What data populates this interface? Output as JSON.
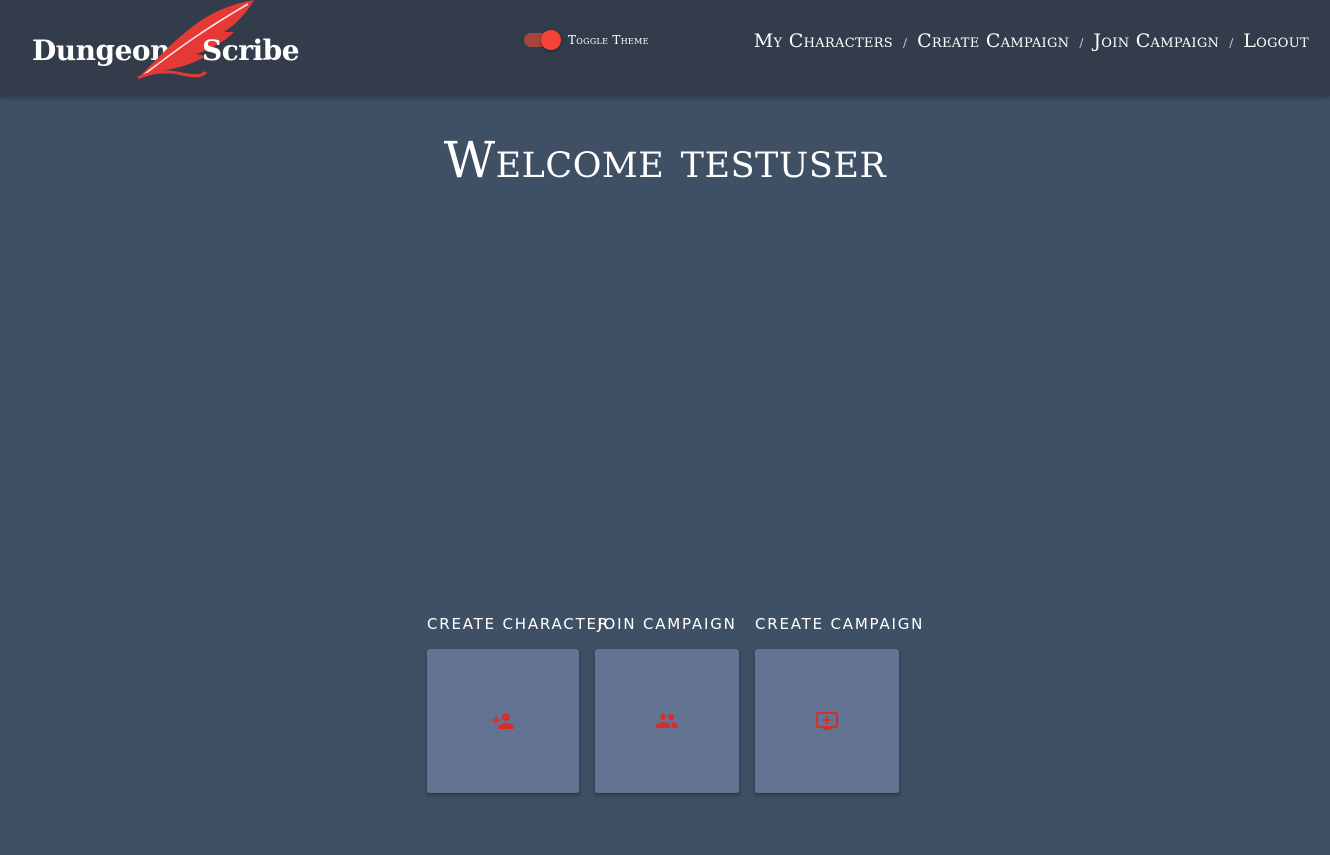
{
  "brand": {
    "word1": "Dungeon",
    "word2": "Scribe",
    "logo_icon": "quill-feather-icon",
    "accent_color": "#e53935"
  },
  "theme_toggle": {
    "label": "Toggle Theme",
    "state": "on"
  },
  "nav": {
    "items": [
      {
        "label": "My Characters"
      },
      {
        "label": "Create Campaign"
      },
      {
        "label": "Join Campaign"
      },
      {
        "label": "Logout"
      }
    ],
    "separator": "/"
  },
  "main": {
    "welcome": "Welcome testuser"
  },
  "actions": [
    {
      "title": "Create Character",
      "icon": "person-add-icon"
    },
    {
      "title": "Join Campaign",
      "icon": "group-icon"
    },
    {
      "title": "Create Campaign",
      "icon": "add-to-queue-icon"
    }
  ],
  "colors": {
    "navbar": "#323c4a",
    "background": "#3f4f64",
    "card": "#627491",
    "icon": "#d32f2f"
  }
}
